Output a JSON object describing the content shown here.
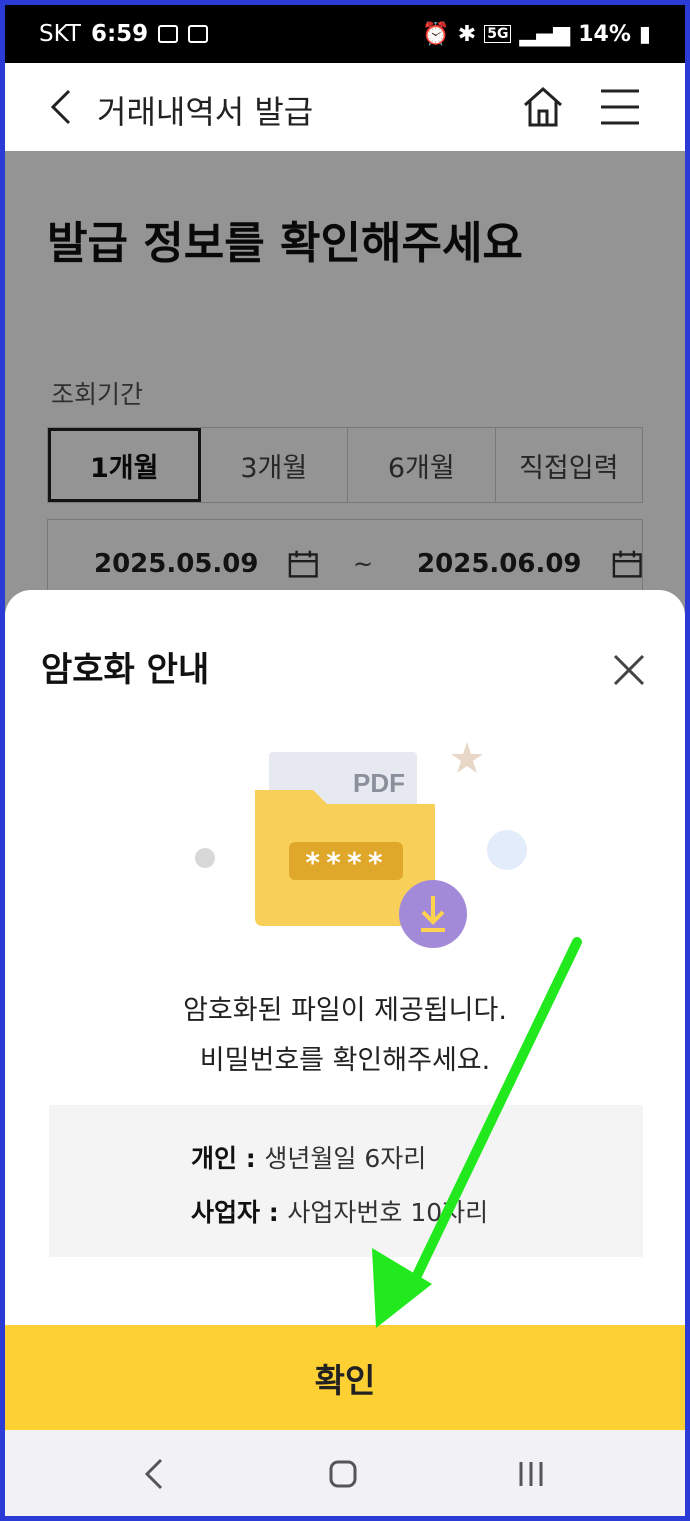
{
  "status_bar": {
    "carrier": "SKT",
    "time": "6:59",
    "battery": "14%",
    "network": "5G"
  },
  "header": {
    "title": "거래내역서 발급"
  },
  "page": {
    "heading": "발급 정보를 확인해주세요",
    "period_label": "조회기간",
    "period_tabs": [
      {
        "label": "1개월",
        "active": true
      },
      {
        "label": "3개월",
        "active": false
      },
      {
        "label": "6개월",
        "active": false
      },
      {
        "label": "직접입력",
        "active": false
      }
    ],
    "start_date": "2025.05.09",
    "date_separator": "~",
    "end_date": "2025.06.09"
  },
  "sheet": {
    "title": "암호화 안내",
    "pdf_label": "PDF",
    "password_mask": "****",
    "message_line1": "암호화된 파일이 제공됩니다.",
    "message_line2": "비밀번호를 확인해주세요.",
    "info": [
      {
        "label": "개인",
        "separator": " : ",
        "value": "생년월일 6자리"
      },
      {
        "label": "사업자",
        "separator": " : ",
        "value": "사업자번호 10자리"
      }
    ],
    "confirm_label": "확인"
  },
  "colors": {
    "confirm_button": "#fdd034",
    "folder": "#f7cf59",
    "annotation_arrow": "#22e81e",
    "frame_border": "#2b3bd6"
  }
}
